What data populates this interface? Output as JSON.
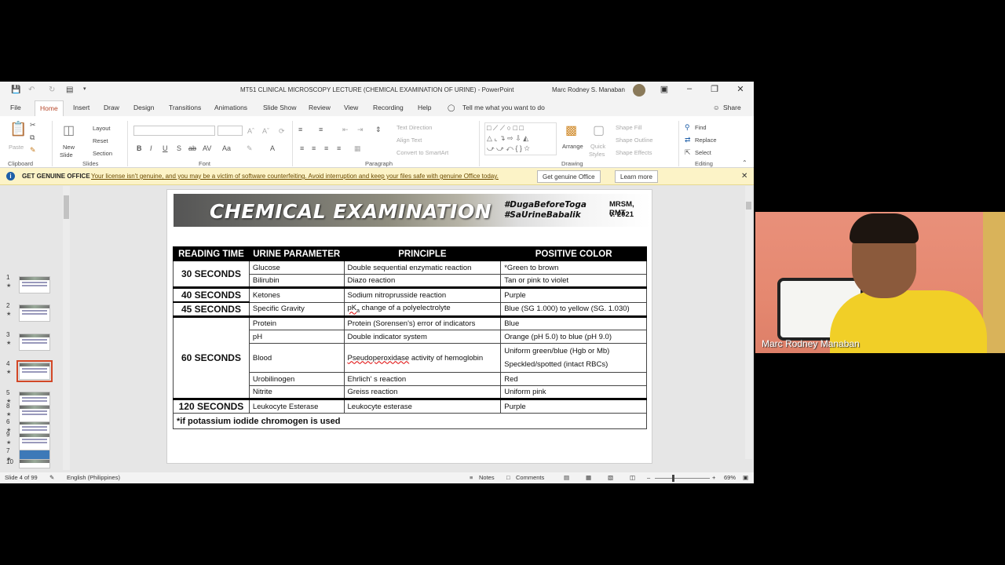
{
  "window": {
    "title": "MT51 CLINICAL MICROSCOPY LECTURE (CHEMICAL EXAMINATION OF URINE)  -  PowerPoint",
    "user": "Marc Rodney S. Manaban"
  },
  "tabs": [
    "File",
    "Home",
    "Insert",
    "Draw",
    "Design",
    "Transitions",
    "Animations",
    "Slide Show",
    "Review",
    "View",
    "Recording",
    "Help"
  ],
  "tell_me": "Tell me what you want to do",
  "share": "Share",
  "ribbon": {
    "clipboard": {
      "paste": "Paste",
      "label": "Clipboard"
    },
    "slides": {
      "new_slide": "New",
      "new_slide2": "Slide",
      "layout": "Layout",
      "reset": "Reset",
      "section": "Section",
      "label": "Slides"
    },
    "font": {
      "label": "Font"
    },
    "paragraph": {
      "text_direction": "Text Direction",
      "align_text": "Align Text",
      "convert": "Convert to SmartArt",
      "label": "Paragraph"
    },
    "drawing": {
      "arrange": "Arrange",
      "quick_styles": "Quick",
      "quick_styles2": "Styles",
      "shape_fill": "Shape Fill",
      "shape_outline": "Shape Outline",
      "shape_effects": "Shape Effects",
      "label": "Drawing"
    },
    "editing": {
      "find": "Find",
      "replace": "Replace",
      "select": "Select",
      "label": "Editing"
    }
  },
  "notice": {
    "heading": "GET GENUINE OFFICE",
    "message": "Your license isn't genuine, and you may be a victim of software counterfeiting. Avoid interruption and keep your files safe with genuine Office today.",
    "button1": "Get genuine Office",
    "button2": "Learn more"
  },
  "thumbnails": [
    "1",
    "2",
    "3",
    "4",
    "5",
    "6",
    "7",
    "8",
    "9",
    "10"
  ],
  "slide": {
    "banner_title": "CHEMICAL EXAMINATION",
    "tag1": "#DugaBeforeToga",
    "tag2": "#SaUrineBabalik",
    "author": "MRSM, RMT",
    "version": "v. 2021",
    "headers": [
      "READING TIME",
      "URINE PARAMETER",
      "PRINCIPLE",
      "POSITIVE COLOR"
    ],
    "times": {
      "t30": "30 SECONDS",
      "t40": "40 SECONDS",
      "t45": "45 SECONDS",
      "t60": "60 SECONDS",
      "t120": "120 SECONDS"
    },
    "rows": [
      {
        "param": "Glucose",
        "principle": "Double sequential enzymatic reaction",
        "color": "*Green to brown"
      },
      {
        "param": "Bilirubin",
        "principle": "Diazo reaction",
        "color": "Tan or pink to violet"
      },
      {
        "param": "Ketones",
        "principle": "Sodium nitroprusside reaction",
        "color": "Purple"
      },
      {
        "param": "Specific Gravity",
        "principle_a": "pK",
        "principle_b": "a",
        "principle_c": " change of a polyelectrolyte",
        "color": "Blue (SG 1.000) to yellow (SG. 1.030)"
      },
      {
        "param": "Protein",
        "principle": "Protein (Sorensen's) error of indicators",
        "color": "Blue"
      },
      {
        "param": "pH",
        "principle": "Double indicator system",
        "color": "Orange (pH 5.0) to blue (pH 9.0)"
      },
      {
        "param": "Blood",
        "principle_a": "Pseudoperoxidase",
        "principle_b": " activity of hemoglobin",
        "color": "Uniform green/blue (Hgb or Mb)",
        "color2": "Speckled/spotted (intact RBCs)"
      },
      {
        "param": "Urobilinogen",
        "principle": "Ehrlich' s reaction",
        "color": "Red"
      },
      {
        "param": "Nitrite",
        "principle": "Greiss reaction",
        "color": "Uniform pink"
      },
      {
        "param": "Leukocyte Esterase",
        "principle": "Leukocyte esterase",
        "color": "Purple"
      }
    ],
    "footnote": "*if potassium iodide chromogen is used"
  },
  "status": {
    "slide_count": "Slide 4 of 99",
    "language": "English (Philippines)",
    "notes": "Notes",
    "comments": "Comments",
    "zoom": "69%"
  },
  "webcam": {
    "name": "Marc Rodney Manaban"
  },
  "colors": {
    "accent": "#b7472a",
    "notice_bg": "#fcf3c7",
    "shirt": "#f1cf27"
  }
}
